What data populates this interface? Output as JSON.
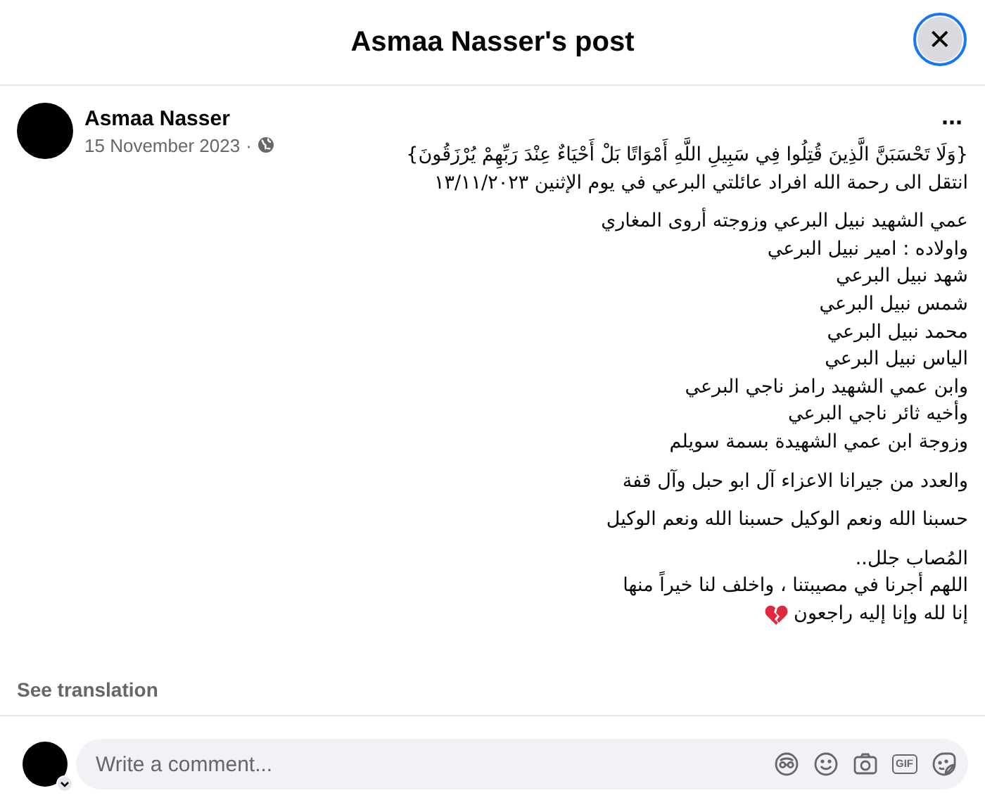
{
  "dialog": {
    "title": "Asmaa Nasser's post",
    "close": "✕"
  },
  "post": {
    "author": "Asmaa Nasser",
    "date": "15 November 2023",
    "separator": "·",
    "more": "···",
    "paragraphs": [
      [
        "{وَلَا تَحْسَبَنَّ الَّذِينَ قُتِلُوا فِي سَبِيلِ اللَّهِ أَمْوَاتًا بَلْ أَحْيَاءٌ عِنْدَ رَبِّهِمْ يُرْزَقُونَ}",
        "انتقل الى رحمة الله افراد عائلتي البرعي في يوم الإثنين  ١٣/١١/٢٠٢٣"
      ],
      [
        "عمي الشهيد نبيل البرعي وزوجته أروى المغاري",
        "واولاده : امير نبيل البرعي",
        "شهد نبيل البرعي",
        "شمس نبيل البرعي",
        "محمد نبيل البرعي",
        "الياس نبيل البرعي",
        "وابن عمي الشهيد رامز ناجي البرعي",
        "وأخيه ثائر ناجي البرعي",
        "وزوجة ابن عمي الشهيدة بسمة سويلم"
      ],
      [
        "والعدد من جيرانا الاعزاء آل ابو حبل وآل قفة"
      ],
      [
        "حسبنا الله ونعم الوكيل حسبنا الله ونعم  الوكيل"
      ],
      [
        "المُصاب جلل..",
        "اللهم أجرنا في مصيبتنا ، واخلف لنا خيراً منها",
        "إنا لله وإنا إليه راجعون"
      ]
    ],
    "see_translation": "See translation"
  },
  "comment": {
    "placeholder": "Write a comment...",
    "gif": "GIF"
  }
}
